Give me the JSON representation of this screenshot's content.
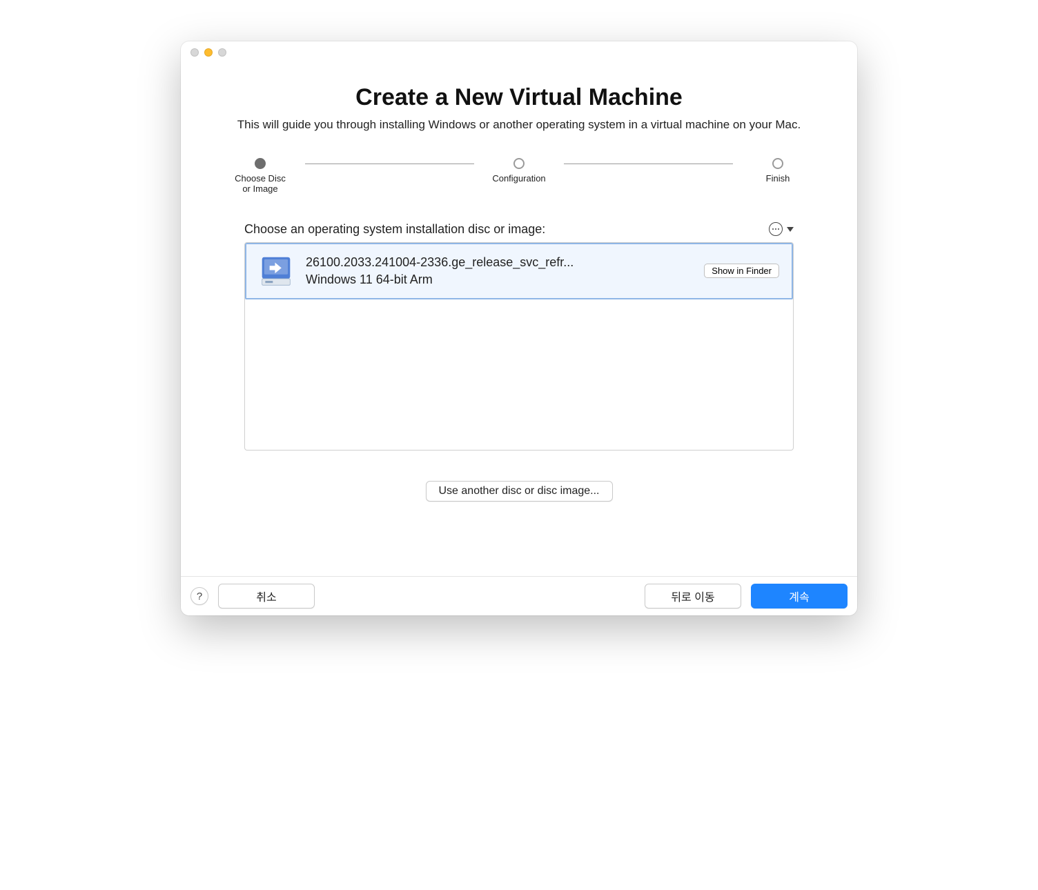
{
  "header": {
    "title": "Create a New Virtual Machine",
    "subtitle": "This will guide you through installing Windows or another operating system in a virtual machine on your Mac."
  },
  "stepper": {
    "steps": [
      {
        "label": "Choose Disc\nor Image",
        "active": true
      },
      {
        "label": "Configuration",
        "active": false
      },
      {
        "label": "Finish",
        "active": false
      }
    ]
  },
  "section": {
    "prompt": "Choose an operating system installation disc or image:"
  },
  "disc_list": {
    "items": [
      {
        "title": "26100.2033.241004-2336.ge_release_svc_refr...",
        "subtitle": "Windows 11 64-bit Arm",
        "finder_label": "Show in Finder"
      }
    ]
  },
  "actions": {
    "use_another": "Use another disc or disc image..."
  },
  "footer": {
    "help": "?",
    "cancel": "취소",
    "back": "뒤로 이동",
    "continue": "계속"
  }
}
